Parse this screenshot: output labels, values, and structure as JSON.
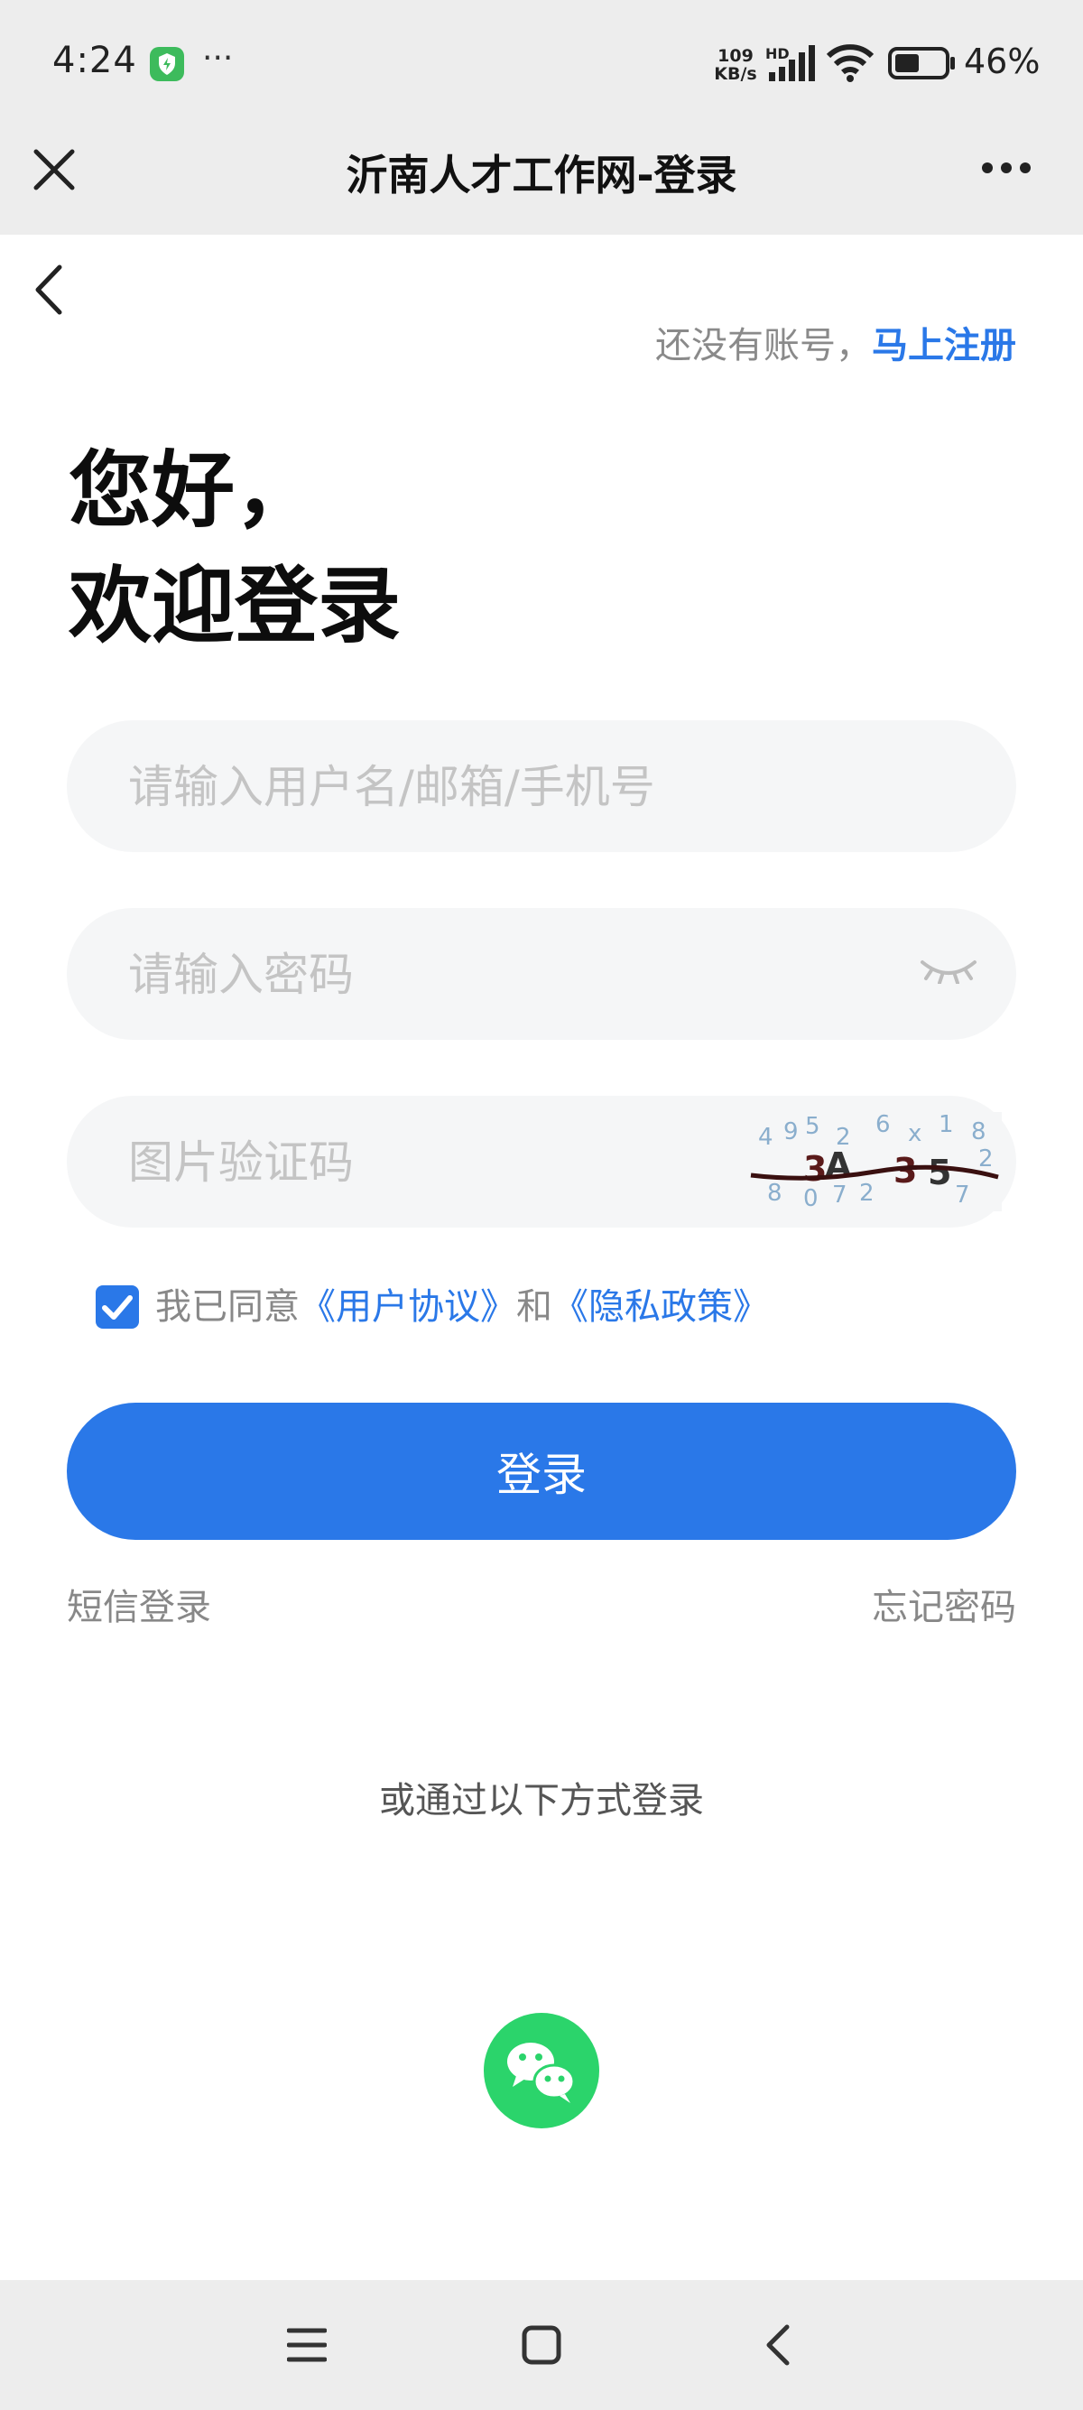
{
  "status_bar": {
    "time": "4:24",
    "more": "···",
    "net_speed_value": "109",
    "net_speed_unit": "KB/s",
    "network_label": "HD",
    "battery": "46%"
  },
  "title_bar": {
    "title": "沂南人才工作网-登录"
  },
  "header": {
    "register_prompt": "还没有账号，",
    "register_link": "马上注册"
  },
  "greeting": {
    "line1": "您好，",
    "line2": "欢迎登录"
  },
  "form": {
    "username_placeholder": "请输入用户名/邮箱/手机号",
    "password_placeholder": "请输入密码",
    "captcha_placeholder": "图片验证码",
    "agreement_prefix": "我已同意",
    "user_agreement": "《用户协议》",
    "and": "和",
    "privacy_policy": "《隐私政策》",
    "agreement_checked": true
  },
  "actions": {
    "login": "登录",
    "sms_login": "短信登录",
    "forgot_password": "忘记密码"
  },
  "alt_login": {
    "title": "或通过以下方式登录",
    "wechat_icon": "wechat-icon"
  },
  "colors": {
    "accent": "#2a78e8",
    "wechat": "#2bd46b",
    "bar_bg": "#ededed"
  }
}
